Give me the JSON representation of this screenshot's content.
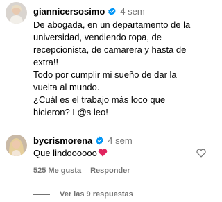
{
  "comment1": {
    "username": "giannicersosimo",
    "time": "4 sem",
    "lines": [
      "De abogada, en un departamento de la",
      "universidad, vendiendo ropa, de",
      "recepcionista, de camarera y hasta de",
      "extra!!",
      "Todo por cumplir mi sueño de dar la",
      "vuelta al mundo.",
      "¿Cuál es el trabajo más loco que",
      "hicieron? L@s leo!"
    ]
  },
  "reply1": {
    "username": "bycrismorena",
    "time": "4 sem",
    "text": "Que lindoooooo",
    "likes": "525 Me gusta",
    "reply_label": "Responder",
    "view_replies": "Ver las 9 respuestas"
  },
  "colors": {
    "verified": "#0095f6",
    "secondary_text": "#737373",
    "heart_emoji": "#e0245e"
  }
}
